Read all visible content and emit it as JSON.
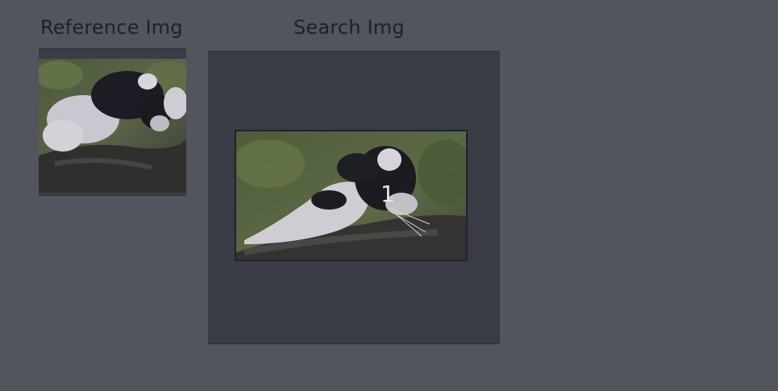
{
  "reference": {
    "label": "Reference Img"
  },
  "search": {
    "label": "Search Img",
    "matches": [
      {
        "number": "1"
      }
    ]
  }
}
